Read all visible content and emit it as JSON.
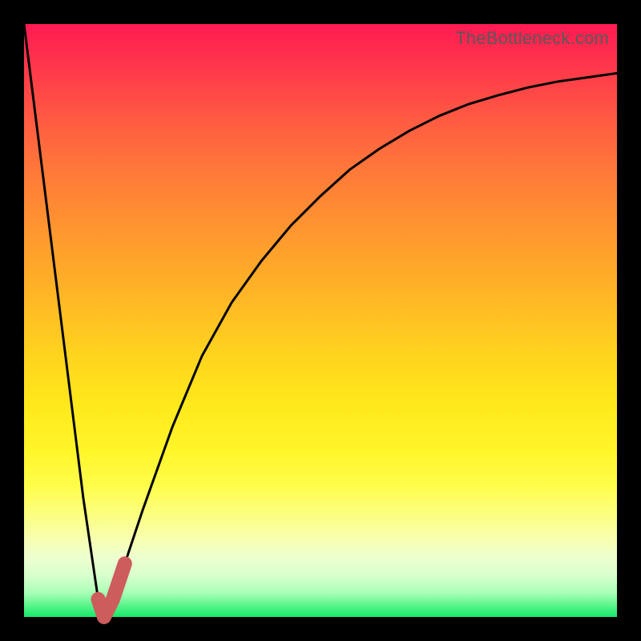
{
  "watermark": "TheBottleneck.com",
  "colors": {
    "background": "#000000",
    "curve": "#000000",
    "highlight": "#cd5c5c",
    "gradient_top": "#ff1a52",
    "gradient_bottom": "#16e86a"
  },
  "chart_data": {
    "type": "line",
    "title": "",
    "xlabel": "",
    "ylabel": "",
    "xlim": [
      0,
      100
    ],
    "ylim": [
      0,
      100
    ],
    "grid": false,
    "series": [
      {
        "name": "bottleneck-curve",
        "x": [
          0,
          5,
          10,
          12.5,
          13.5,
          15,
          17,
          20,
          25,
          30,
          35,
          40,
          45,
          50,
          55,
          60,
          65,
          70,
          75,
          80,
          85,
          90,
          95,
          100
        ],
        "y": [
          100,
          60,
          20,
          3,
          0,
          3,
          9,
          18,
          32,
          44,
          53,
          60,
          66,
          71,
          75.5,
          79,
          82,
          84.5,
          86.5,
          88,
          89.3,
          90.3,
          91,
          91.7
        ]
      },
      {
        "name": "highlight-segment",
        "x": [
          12.5,
          13.5,
          15,
          17
        ],
        "y": [
          3,
          0,
          3,
          9
        ]
      }
    ],
    "annotations": []
  }
}
